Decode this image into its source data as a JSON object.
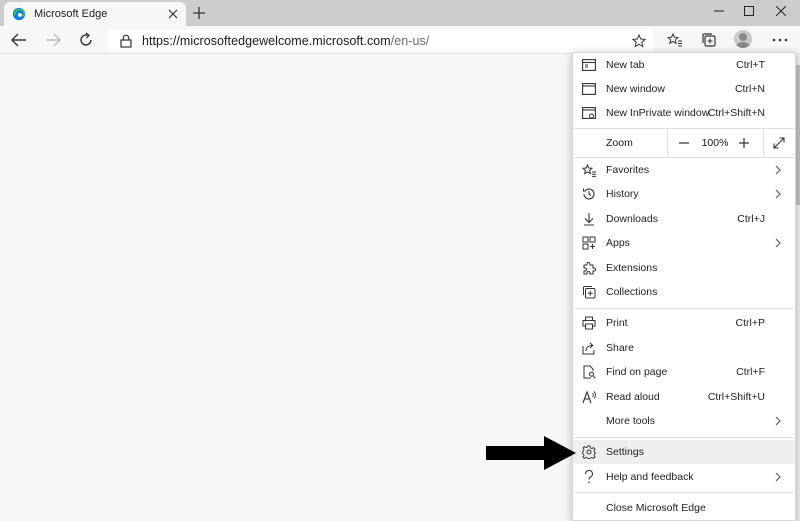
{
  "tab": {
    "title": "Microsoft Edge"
  },
  "address": {
    "url_host": "https://microsoftedgewelcome.microsoft.com",
    "url_path": "/en-us/"
  },
  "menu": {
    "new_tab": {
      "label": "New tab",
      "shortcut": "Ctrl+T"
    },
    "new_window": {
      "label": "New window",
      "shortcut": "Ctrl+N"
    },
    "new_inprivate": {
      "label": "New InPrivate window",
      "shortcut": "Ctrl+Shift+N"
    },
    "zoom": {
      "label": "Zoom",
      "value": "100%",
      "minus": "—",
      "plus": "+"
    },
    "favorites": {
      "label": "Favorites"
    },
    "history": {
      "label": "History"
    },
    "downloads": {
      "label": "Downloads",
      "shortcut": "Ctrl+J"
    },
    "apps": {
      "label": "Apps"
    },
    "extensions": {
      "label": "Extensions"
    },
    "collections": {
      "label": "Collections"
    },
    "print": {
      "label": "Print",
      "shortcut": "Ctrl+P"
    },
    "share": {
      "label": "Share"
    },
    "find": {
      "label": "Find on page",
      "shortcut": "Ctrl+F"
    },
    "read_aloud": {
      "label": "Read aloud",
      "shortcut": "Ctrl+Shift+U"
    },
    "more_tools": {
      "label": "More tools"
    },
    "settings": {
      "label": "Settings"
    },
    "help": {
      "label": "Help and feedback"
    },
    "close": {
      "label": "Close Microsoft Edge"
    }
  },
  "colors": {
    "highlight": "#efefef",
    "edge_blue": "#0f7bd6",
    "edge_green": "#3fbf6a"
  }
}
